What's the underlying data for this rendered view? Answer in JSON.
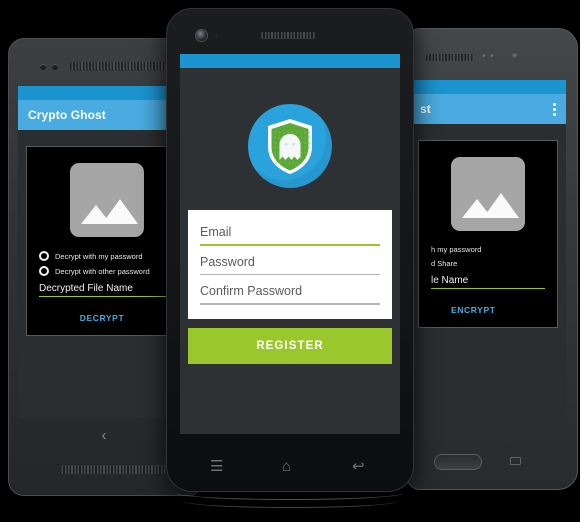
{
  "app": {
    "name": "Crypto Ghost",
    "accent_blue": "#49abdf",
    "status_blue": "#1b94d0",
    "accent_green": "#9ac72b"
  },
  "phone_left": {
    "device": "left-phone-decrypt",
    "actionbar_title": "Crypto Ghost",
    "image_placeholder_icon": "image-placeholder-icon",
    "options": [
      {
        "label": "Decrypt with my password",
        "selected": false
      },
      {
        "label": "Decrypt with other password",
        "selected": false
      }
    ],
    "field_label": "Decrypted File Name",
    "action_label": "DECRYPT",
    "nav": {
      "back_icon": "back-chevron-icon"
    }
  },
  "phone_center": {
    "device": "center-phone-register",
    "logo_icon": "crypto-ghost-shield-logo",
    "fields": [
      {
        "name": "email",
        "placeholder": "Email",
        "value": "",
        "focused": true
      },
      {
        "name": "password",
        "placeholder": "Password",
        "value": "",
        "focused": false
      },
      {
        "name": "confirm_password",
        "placeholder": "Confirm Password",
        "value": "",
        "focused": false
      }
    ],
    "submit_label": "REGISTER",
    "nav": {
      "menu_icon": "hamburger-menu-icon",
      "home_icon": "home-icon",
      "back_icon": "back-arrow-icon"
    }
  },
  "phone_right": {
    "device": "right-phone-encrypt",
    "actionbar_title": "st",
    "overflow_icon": "kebab-menu-icon",
    "image_placeholder_icon": "image-placeholder-icon",
    "options": [
      {
        "label": "h my password",
        "selected": false
      },
      {
        "label": "d Share",
        "selected": false
      }
    ],
    "field_label": "le Name",
    "action_label": "ENCRYPT",
    "nav": {
      "home_icon": "home-button",
      "recents_icon": "recents-key-icon"
    }
  }
}
